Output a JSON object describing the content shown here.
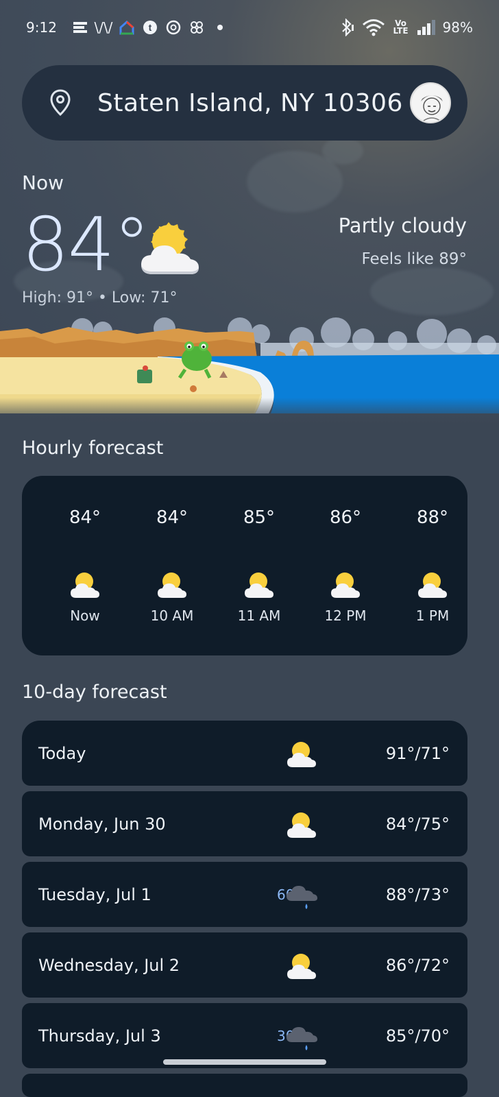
{
  "status_bar": {
    "time": "9:12",
    "battery": "98%",
    "network": "Vo LTE"
  },
  "search": {
    "location": "Staten Island, NY 10306"
  },
  "current": {
    "label": "Now",
    "temp": "84°",
    "condition": "Partly cloudy",
    "feels_like": "Feels like 89°",
    "high_low": "High: 91° • Low: 71°",
    "icon": "partly-cloudy-icon"
  },
  "hourly": {
    "title": "Hourly forecast",
    "items": [
      {
        "temp": "84°",
        "time": "Now",
        "icon": "partly-cloudy-icon"
      },
      {
        "temp": "84°",
        "time": "10 AM",
        "icon": "partly-cloudy-icon"
      },
      {
        "temp": "85°",
        "time": "11 AM",
        "icon": "partly-cloudy-icon"
      },
      {
        "temp": "86°",
        "time": "12 PM",
        "icon": "partly-cloudy-icon"
      },
      {
        "temp": "88°",
        "time": "1 PM",
        "icon": "partly-cloudy-icon"
      }
    ]
  },
  "daily": {
    "title": "10-day forecast",
    "items": [
      {
        "day": "Today",
        "precip": "",
        "temps": "91°/71°",
        "icon": "partly-cloudy-icon"
      },
      {
        "day": "Monday, Jun 30",
        "precip": "",
        "temps": "84°/75°",
        "icon": "partly-cloudy-icon"
      },
      {
        "day": "Tuesday, Jul 1",
        "precip": "60%",
        "temps": "88°/73°",
        "icon": "rain-cloud-icon"
      },
      {
        "day": "Wednesday, Jul 2",
        "precip": "",
        "temps": "86°/72°",
        "icon": "partly-cloudy-icon"
      },
      {
        "day": "Thursday, Jul 3",
        "precip": "30%",
        "temps": "85°/70°",
        "icon": "rain-cloud-icon"
      }
    ]
  },
  "colors": {
    "background": "#3b4654",
    "card": "#0f1c29",
    "sun": "#f7c933",
    "precip_text": "#8cb8f5",
    "ocean": "#0a7fd8"
  }
}
